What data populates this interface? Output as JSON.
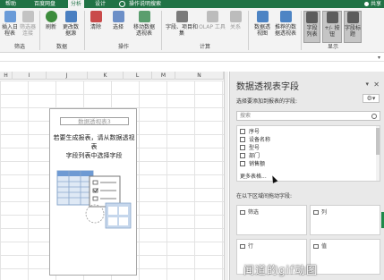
{
  "ribbon_tabs": [
    {
      "label": "帮助"
    },
    {
      "label": "百度网盘"
    },
    {
      "label": "分析",
      "active": true
    },
    {
      "label": "设计"
    },
    {
      "label": "操作说明搜索"
    }
  ],
  "share_label": "共享",
  "ribbon_groups": {
    "filter": {
      "label": "筛选",
      "buttons": [
        "插入日程表",
        "筛选器连接"
      ]
    },
    "data": {
      "label": "数据",
      "buttons": [
        "刷新",
        "更改数据源"
      ]
    },
    "actions": {
      "label": "操作",
      "buttons": [
        "清除",
        "选择",
        "移动数据透视表"
      ]
    },
    "calculations": {
      "label": "计算",
      "buttons": [
        "字段、项目和集",
        "OLAP 工具",
        "关系"
      ]
    },
    "tools": {
      "buttons": [
        "数据透视图",
        "推荐的数据透视表"
      ]
    },
    "show": {
      "label": "显示",
      "buttons": [
        "字段列表",
        "+/- 按钮",
        "字段标题"
      ]
    }
  },
  "column_headers": [
    "H",
    "I",
    "J",
    "K",
    "L",
    "M",
    "N"
  ],
  "pivot_placeholder": {
    "title": "数据透视表3",
    "hint_line1": "若要生成报表，请从数据透视表",
    "hint_line2": "字段列表中选择字段"
  },
  "field_pane": {
    "title": "数据透视表字段",
    "subtitle": "选择要添加到报表的字段:",
    "search_placeholder": "搜索",
    "fields": [
      "序号",
      "设备名称",
      "型号",
      "部门",
      "销售额",
      "更多表格..."
    ],
    "drag_hint": "在以下区域间拖动字段:",
    "areas": {
      "filter": "筛选",
      "columns": "列",
      "rows": "行",
      "values": "值"
    }
  },
  "watermark": "闻道的gif动图",
  "colors": {
    "ribbon_green": "#217346",
    "ribbon_bg": "#f3f3f3",
    "pane_bg": "#e9e9e9"
  }
}
